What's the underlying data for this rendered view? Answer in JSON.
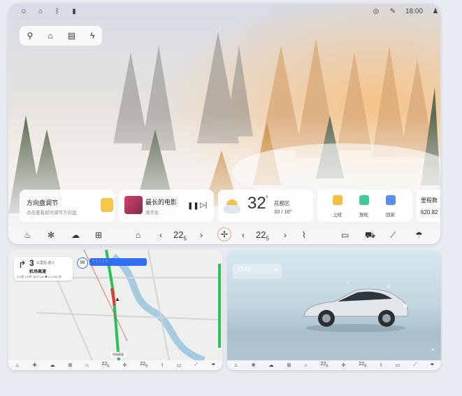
{
  "status_bar": {
    "time": "18:00"
  },
  "steering_card": {
    "title": "方向盘调节",
    "subtitle": "点击查看如何调节方向盘"
  },
  "music_card": {
    "title": "最长的电影",
    "artist": "周杰伦"
  },
  "weather_card": {
    "temp": "32",
    "degree": "°",
    "district": "花都区",
    "range": "33 / 16°"
  },
  "modes_card": {
    "items": [
      "上班",
      "放松",
      "回家"
    ]
  },
  "range_card": {
    "title": "里程数",
    "value": "620.82"
  },
  "dock": {
    "temp_left": "22",
    "temp_left_dec": "5",
    "temp_right": "22",
    "temp_right_dec": "5",
    "prev": "‹",
    "next": "›"
  },
  "map": {
    "distance": "3",
    "distance_unit": "公里后 进入",
    "road": "机场高速",
    "stats": "2公里  1小时 35分  345 ◆ 4       19:05 到",
    "speed_limit": "98",
    "destination": "机场高速",
    "lane_text": "↑  ↑  ↑  ↑  ↑ "
  },
  "car_widget": {
    "time": "12:08"
  },
  "mini_dock": {
    "temp_left": "22",
    "temp_left_dec": "5",
    "temp_right": "22",
    "temp_right_dec": "5"
  },
  "colors": {
    "accent": "#2f6df6",
    "route_green": "#2cbf5a",
    "route_red": "#e23b3b"
  }
}
